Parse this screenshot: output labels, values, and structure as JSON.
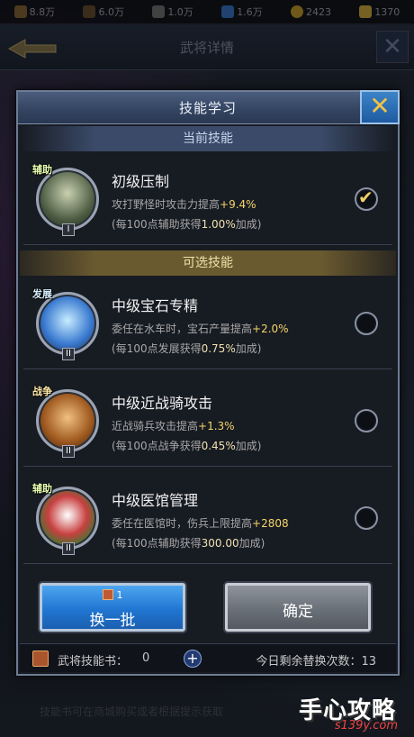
{
  "topbar": {
    "resources": [
      {
        "icon": "food-icon",
        "value": "8.8万"
      },
      {
        "icon": "wood-icon",
        "value": "6.0万"
      },
      {
        "icon": "stone-icon",
        "value": "1.0万"
      },
      {
        "icon": "gem-icon",
        "value": "1.6万"
      },
      {
        "icon": "gold-coin-icon",
        "value": "2423"
      },
      {
        "icon": "gold-ingot-icon",
        "value": "1370"
      }
    ]
  },
  "background": {
    "title": "武将详情",
    "footer_hint": "技能书可在商城购买或者根据提示获取"
  },
  "dialog": {
    "title": "技能学习",
    "close_icon": "close-icon",
    "current_section": "当前技能",
    "optional_section": "可选技能",
    "current_skill": {
      "tag": "辅助",
      "level": "I",
      "name": "初级压制",
      "desc_prefix": "攻打野怪时攻击力提高",
      "desc_value": "+9.4%",
      "sub_prefix": "(每100点辅助获得",
      "sub_value": "1.00%",
      "sub_suffix": "加成)",
      "selected": true
    },
    "skills": [
      {
        "tag": "发展",
        "level": "II",
        "name": "中级宝石专精",
        "desc_prefix": "委任在水车时，宝石产量提高",
        "desc_value": "+2.0%",
        "sub_prefix": "(每100点发展获得",
        "sub_value": "0.75%",
        "sub_suffix": "加成)"
      },
      {
        "tag": "战争",
        "level": "II",
        "name": "中级近战骑攻击",
        "desc_prefix": "近战骑兵攻击提高",
        "desc_value": "+1.3%",
        "sub_prefix": "(每100点战争获得",
        "sub_value": "0.45%",
        "sub_suffix": "加成)"
      },
      {
        "tag": "辅助",
        "level": "II",
        "name": "中级医馆管理",
        "desc_prefix": "委任在医馆时，伤兵上限提高",
        "desc_value": "+2808",
        "sub_prefix": "(每100点辅助获得",
        "sub_value": "300.00",
        "sub_suffix": "加成)"
      }
    ],
    "buttons": {
      "refresh_count": "1",
      "refresh_label": "换一批",
      "confirm_label": "确定"
    },
    "footer": {
      "book_label": "武将技能书：",
      "book_count": "0",
      "remaining_label": "今日剩余替换次数：",
      "remaining_count": "13"
    }
  },
  "watermark": {
    "main": "手心攻略",
    "sub": "s139y.com"
  },
  "colors": {
    "highlight": "#f5d66a",
    "confirm_blue": "#2176d2",
    "gold_section": "#6a5a30"
  }
}
